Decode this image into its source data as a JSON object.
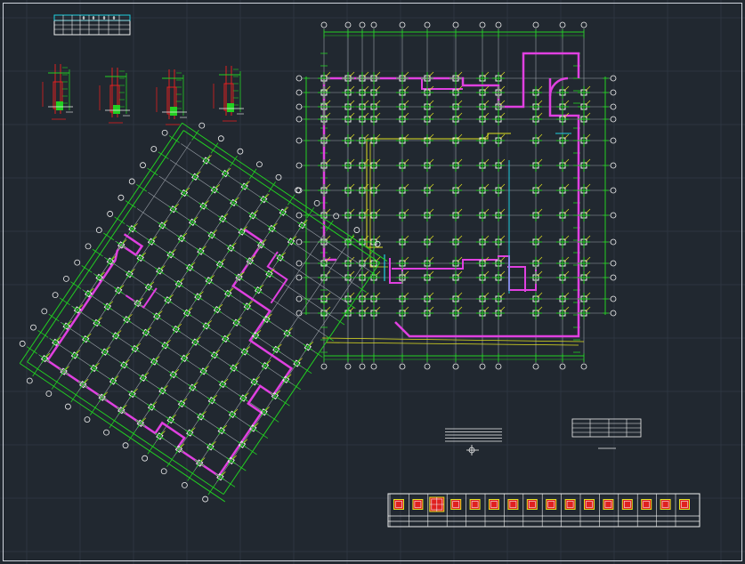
{
  "drawing": {
    "title": "",
    "colors": {
      "background": "#212830",
      "grid": "#2d3540",
      "axis": "#22d022",
      "beam": "#e040e0",
      "column": "#f0f0f0",
      "rebar": "#e0e020",
      "marker": "#f0f0f0",
      "detail_red": "#e02020",
      "gray_line": "#9aa0a8",
      "table_line": "#f0f0f0",
      "cyan": "#20d0e0"
    },
    "legend_table": {
      "header_cells": [
        "",
        "",
        "Φ",
        "Φ",
        "Φ",
        "Φ"
      ]
    },
    "detail_sections_count": 4,
    "schedule_strip_count": 16
  }
}
